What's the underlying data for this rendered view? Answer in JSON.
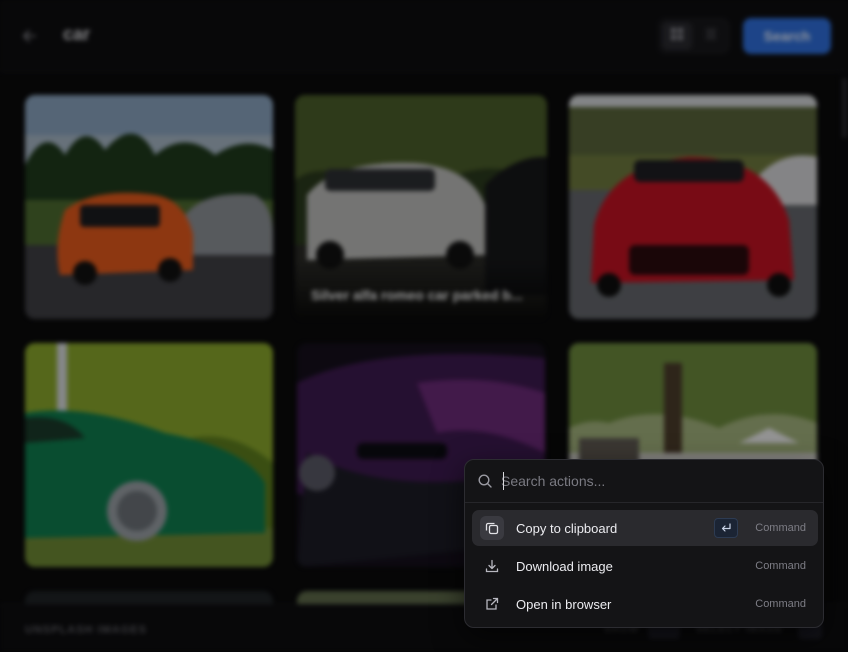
{
  "header": {
    "query": "car",
    "search_label": "Search"
  },
  "grid": {
    "tiles": [
      {
        "caption": ""
      },
      {
        "caption": "Silver alfa romeo car parked b..."
      },
      {
        "caption": ""
      },
      {
        "caption": ""
      },
      {
        "caption": ""
      },
      {
        "caption": ""
      }
    ]
  },
  "footer": {
    "brand": "UNSPLASH IMAGES",
    "hint_1": "SHOW",
    "hint_2": "SELECT IMAGE"
  },
  "palette": {
    "search_placeholder": "Search actions...",
    "search_value": "",
    "actions": [
      {
        "label": "Copy to clipboard",
        "shortcut": "Command",
        "icon": "copy-icon",
        "selected": true
      },
      {
        "label": "Download image",
        "shortcut": "Command",
        "icon": "download-icon",
        "selected": false
      },
      {
        "label": "Open in browser",
        "shortcut": "Command",
        "icon": "external-link-icon",
        "selected": false
      }
    ]
  },
  "colors": {
    "accent": "#2f6fdb",
    "background": "#0a0a0b",
    "palette_bg": "#141416",
    "selected_row": "#2a2a2e"
  }
}
